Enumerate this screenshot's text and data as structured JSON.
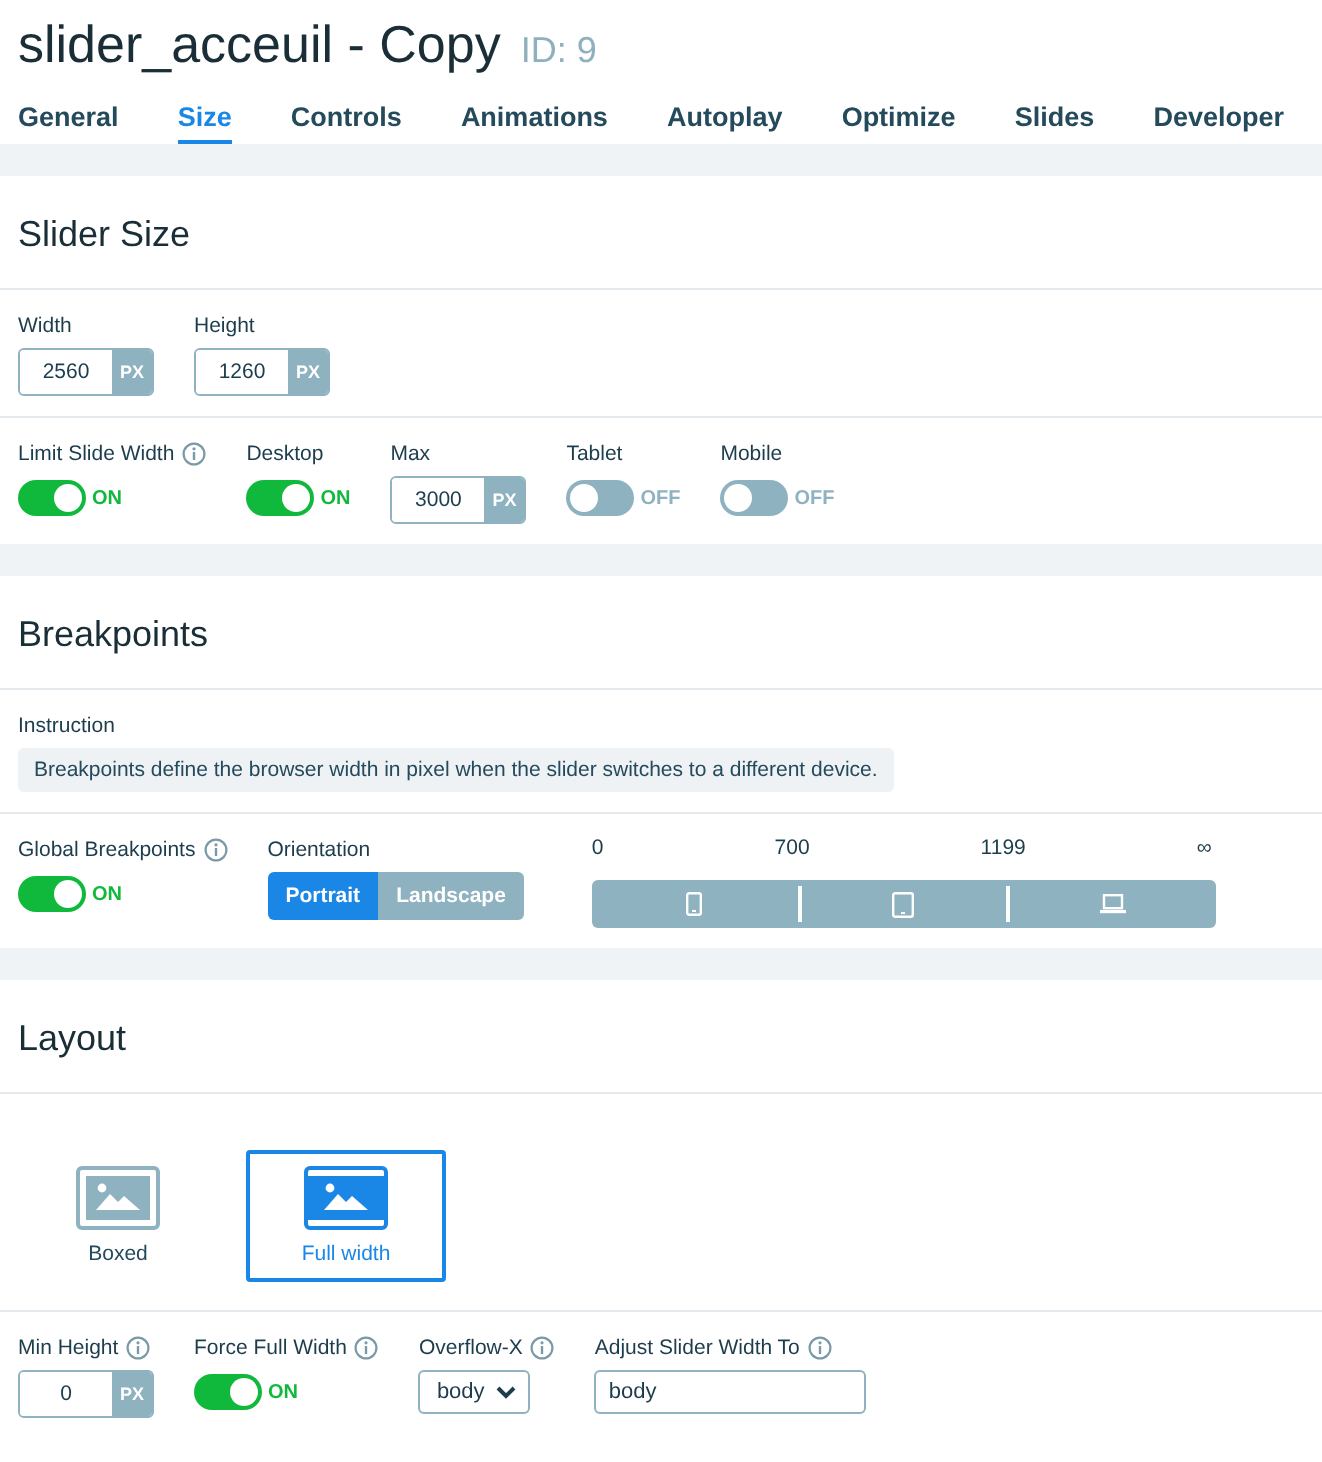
{
  "header": {
    "title": "slider_acceuil - Copy",
    "id": "ID: 9"
  },
  "tabs": [
    {
      "label": "General",
      "selected": false
    },
    {
      "label": "Size",
      "selected": true
    },
    {
      "label": "Controls",
      "selected": false
    },
    {
      "label": "Animations",
      "selected": false
    },
    {
      "label": "Autoplay",
      "selected": false
    },
    {
      "label": "Optimize",
      "selected": false
    },
    {
      "label": "Slides",
      "selected": false
    },
    {
      "label": "Developer",
      "selected": false
    }
  ],
  "sections": [
    {
      "title": "Slider Size",
      "rows": [
        [
          {
            "kind": "number",
            "label": "Width",
            "value": "2560",
            "unit": "PX",
            "info": false
          },
          {
            "kind": "number",
            "label": "Height",
            "value": "1260",
            "unit": "PX",
            "info": false
          }
        ],
        [
          {
            "kind": "toggle",
            "label": "Limit Slide Width",
            "info": true,
            "on": true,
            "state_text": "ON"
          },
          {
            "kind": "toggle",
            "label": "Desktop",
            "info": false,
            "on": true,
            "state_text": "ON"
          },
          {
            "kind": "number",
            "label": "Max",
            "value": "3000",
            "unit": "PX",
            "info": false
          },
          {
            "kind": "toggle",
            "label": "Tablet",
            "info": false,
            "on": false,
            "state_text": "OFF"
          },
          {
            "kind": "toggle",
            "label": "Mobile",
            "info": false,
            "on": false,
            "state_text": "OFF"
          }
        ]
      ]
    },
    {
      "title": "Breakpoints",
      "rows": [
        [
          {
            "kind": "instruction",
            "label": "Instruction",
            "text": "Breakpoints define the browser width in pixel when the slider switches to a different device."
          }
        ],
        [
          {
            "kind": "toggle",
            "label": "Global Breakpoints",
            "info": true,
            "on": true,
            "state_text": "ON"
          },
          {
            "kind": "segmented",
            "label": "Orientation",
            "options": [
              {
                "label": "Portrait",
                "selected": true
              },
              {
                "label": "Landscape",
                "selected": false
              }
            ]
          },
          {
            "kind": "breakpoints",
            "values": [
              "0",
              "700",
              "1199",
              "∞"
            ],
            "segments": [
              {
                "kind": "mobile"
              },
              {
                "kind": "tablet"
              },
              {
                "kind": "desktop"
              }
            ]
          }
        ]
      ]
    },
    {
      "title": "Layout",
      "rows": [
        [
          {
            "kind": "layout",
            "options": [
              {
                "label": "Boxed",
                "kind": "boxed",
                "selected": false
              },
              {
                "label": "Full width",
                "kind": "full",
                "selected": true
              }
            ]
          }
        ],
        [
          {
            "kind": "number",
            "label": "Min Height",
            "value": "0",
            "unit": "PX",
            "info": true
          },
          {
            "kind": "toggle",
            "label": "Force Full Width",
            "info": true,
            "on": true,
            "state_text": "ON"
          },
          {
            "kind": "select",
            "label": "Overflow-X",
            "value": "body",
            "info": true
          },
          {
            "kind": "text",
            "label": "Adjust Slider Width To",
            "value": "body",
            "info": true
          }
        ]
      ]
    }
  ]
}
